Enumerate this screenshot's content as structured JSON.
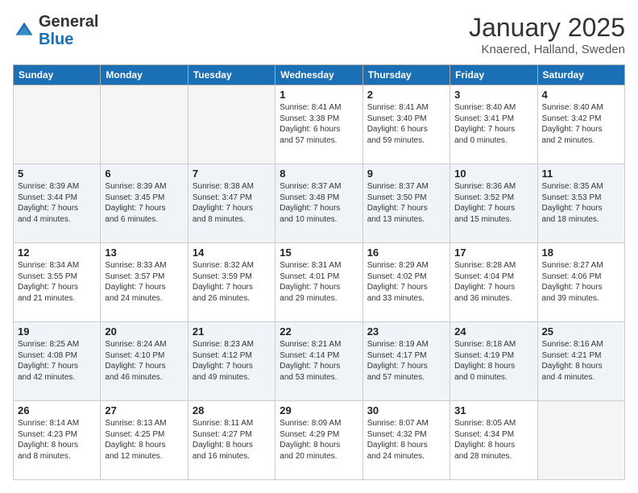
{
  "header": {
    "logo_line1": "General",
    "logo_line2": "Blue",
    "month": "January 2025",
    "location": "Knaered, Halland, Sweden"
  },
  "weekdays": [
    "Sunday",
    "Monday",
    "Tuesday",
    "Wednesday",
    "Thursday",
    "Friday",
    "Saturday"
  ],
  "rows": [
    [
      {
        "day": "",
        "info": ""
      },
      {
        "day": "",
        "info": ""
      },
      {
        "day": "",
        "info": ""
      },
      {
        "day": "1",
        "info": "Sunrise: 8:41 AM\nSunset: 3:38 PM\nDaylight: 6 hours\nand 57 minutes."
      },
      {
        "day": "2",
        "info": "Sunrise: 8:41 AM\nSunset: 3:40 PM\nDaylight: 6 hours\nand 59 minutes."
      },
      {
        "day": "3",
        "info": "Sunrise: 8:40 AM\nSunset: 3:41 PM\nDaylight: 7 hours\nand 0 minutes."
      },
      {
        "day": "4",
        "info": "Sunrise: 8:40 AM\nSunset: 3:42 PM\nDaylight: 7 hours\nand 2 minutes."
      }
    ],
    [
      {
        "day": "5",
        "info": "Sunrise: 8:39 AM\nSunset: 3:44 PM\nDaylight: 7 hours\nand 4 minutes."
      },
      {
        "day": "6",
        "info": "Sunrise: 8:39 AM\nSunset: 3:45 PM\nDaylight: 7 hours\nand 6 minutes."
      },
      {
        "day": "7",
        "info": "Sunrise: 8:38 AM\nSunset: 3:47 PM\nDaylight: 7 hours\nand 8 minutes."
      },
      {
        "day": "8",
        "info": "Sunrise: 8:37 AM\nSunset: 3:48 PM\nDaylight: 7 hours\nand 10 minutes."
      },
      {
        "day": "9",
        "info": "Sunrise: 8:37 AM\nSunset: 3:50 PM\nDaylight: 7 hours\nand 13 minutes."
      },
      {
        "day": "10",
        "info": "Sunrise: 8:36 AM\nSunset: 3:52 PM\nDaylight: 7 hours\nand 15 minutes."
      },
      {
        "day": "11",
        "info": "Sunrise: 8:35 AM\nSunset: 3:53 PM\nDaylight: 7 hours\nand 18 minutes."
      }
    ],
    [
      {
        "day": "12",
        "info": "Sunrise: 8:34 AM\nSunset: 3:55 PM\nDaylight: 7 hours\nand 21 minutes."
      },
      {
        "day": "13",
        "info": "Sunrise: 8:33 AM\nSunset: 3:57 PM\nDaylight: 7 hours\nand 24 minutes."
      },
      {
        "day": "14",
        "info": "Sunrise: 8:32 AM\nSunset: 3:59 PM\nDaylight: 7 hours\nand 26 minutes."
      },
      {
        "day": "15",
        "info": "Sunrise: 8:31 AM\nSunset: 4:01 PM\nDaylight: 7 hours\nand 29 minutes."
      },
      {
        "day": "16",
        "info": "Sunrise: 8:29 AM\nSunset: 4:02 PM\nDaylight: 7 hours\nand 33 minutes."
      },
      {
        "day": "17",
        "info": "Sunrise: 8:28 AM\nSunset: 4:04 PM\nDaylight: 7 hours\nand 36 minutes."
      },
      {
        "day": "18",
        "info": "Sunrise: 8:27 AM\nSunset: 4:06 PM\nDaylight: 7 hours\nand 39 minutes."
      }
    ],
    [
      {
        "day": "19",
        "info": "Sunrise: 8:25 AM\nSunset: 4:08 PM\nDaylight: 7 hours\nand 42 minutes."
      },
      {
        "day": "20",
        "info": "Sunrise: 8:24 AM\nSunset: 4:10 PM\nDaylight: 7 hours\nand 46 minutes."
      },
      {
        "day": "21",
        "info": "Sunrise: 8:23 AM\nSunset: 4:12 PM\nDaylight: 7 hours\nand 49 minutes."
      },
      {
        "day": "22",
        "info": "Sunrise: 8:21 AM\nSunset: 4:14 PM\nDaylight: 7 hours\nand 53 minutes."
      },
      {
        "day": "23",
        "info": "Sunrise: 8:19 AM\nSunset: 4:17 PM\nDaylight: 7 hours\nand 57 minutes."
      },
      {
        "day": "24",
        "info": "Sunrise: 8:18 AM\nSunset: 4:19 PM\nDaylight: 8 hours\nand 0 minutes."
      },
      {
        "day": "25",
        "info": "Sunrise: 8:16 AM\nSunset: 4:21 PM\nDaylight: 8 hours\nand 4 minutes."
      }
    ],
    [
      {
        "day": "26",
        "info": "Sunrise: 8:14 AM\nSunset: 4:23 PM\nDaylight: 8 hours\nand 8 minutes."
      },
      {
        "day": "27",
        "info": "Sunrise: 8:13 AM\nSunset: 4:25 PM\nDaylight: 8 hours\nand 12 minutes."
      },
      {
        "day": "28",
        "info": "Sunrise: 8:11 AM\nSunset: 4:27 PM\nDaylight: 8 hours\nand 16 minutes."
      },
      {
        "day": "29",
        "info": "Sunrise: 8:09 AM\nSunset: 4:29 PM\nDaylight: 8 hours\nand 20 minutes."
      },
      {
        "day": "30",
        "info": "Sunrise: 8:07 AM\nSunset: 4:32 PM\nDaylight: 8 hours\nand 24 minutes."
      },
      {
        "day": "31",
        "info": "Sunrise: 8:05 AM\nSunset: 4:34 PM\nDaylight: 8 hours\nand 28 minutes."
      },
      {
        "day": "",
        "info": ""
      }
    ]
  ]
}
